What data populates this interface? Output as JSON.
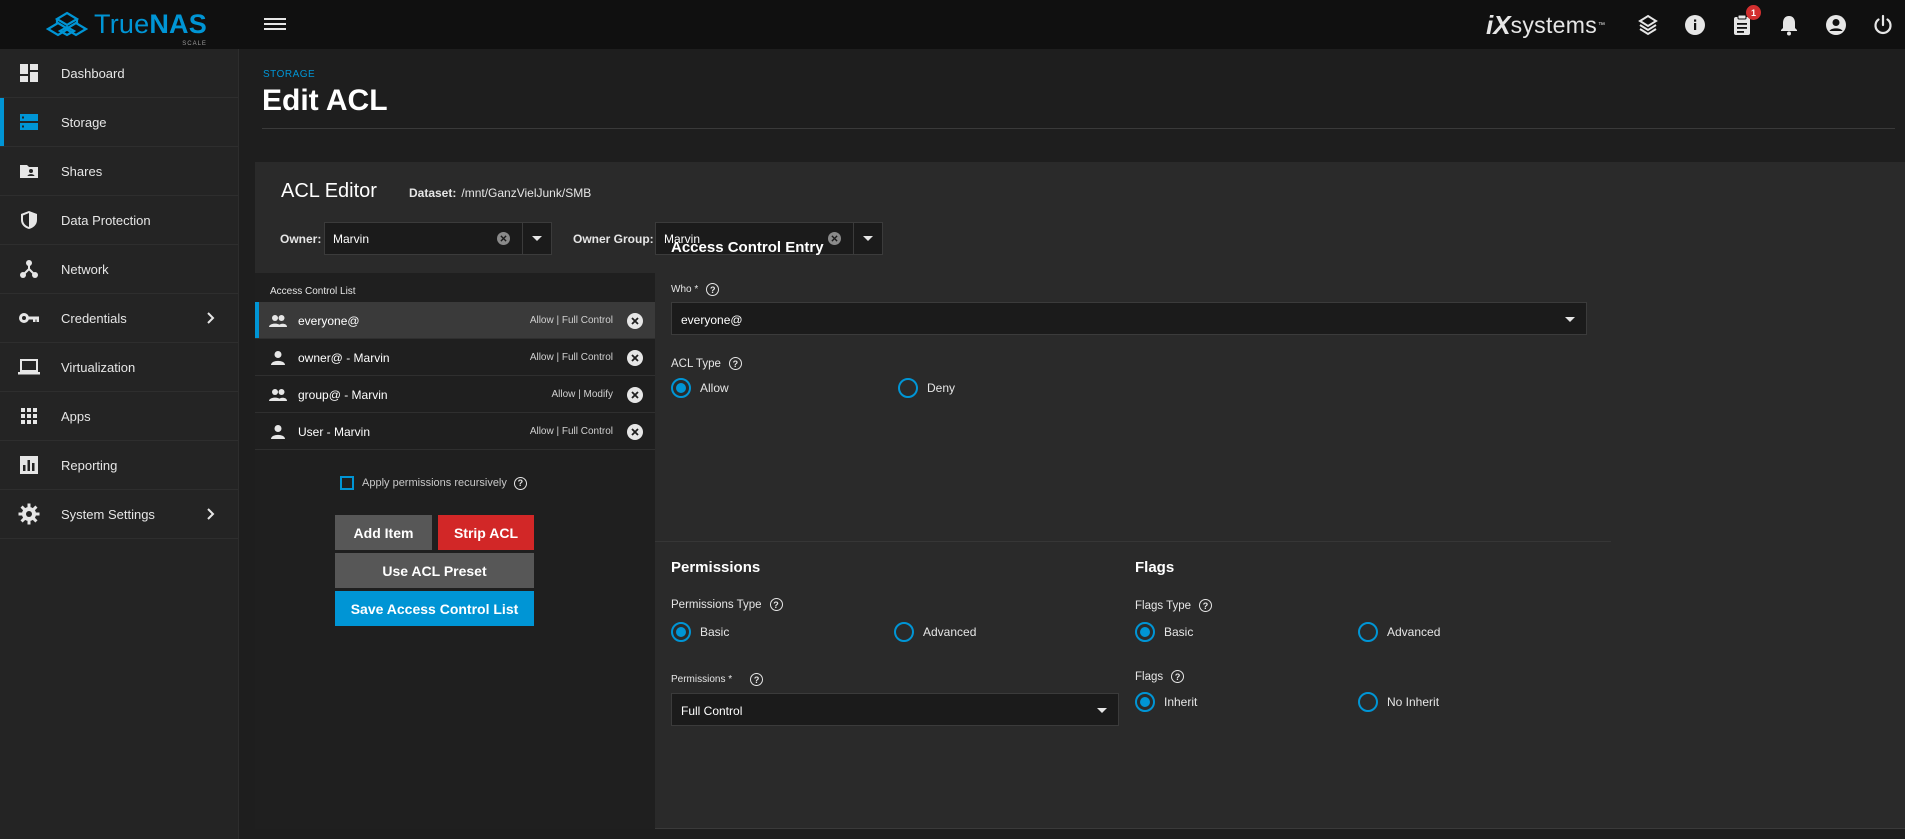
{
  "brand": {
    "name_light": "True",
    "name_bold": "NAS",
    "edition": "SCALE",
    "vendor_ix": "iX",
    "vendor_rest": "systems",
    "vendor_tm": "™",
    "accent": "#0095d5"
  },
  "topbar": {
    "icons": [
      "truecommand-icon",
      "info-icon",
      "tasks-icon",
      "notifications-icon",
      "account-icon",
      "power-icon"
    ],
    "tasks_badge": "1"
  },
  "sidebar": {
    "items": [
      {
        "label": "Dashboard",
        "icon": "dashboard-icon"
      },
      {
        "label": "Storage",
        "icon": "storage-icon",
        "active": true
      },
      {
        "label": "Shares",
        "icon": "shares-icon"
      },
      {
        "label": "Data Protection",
        "icon": "shield-icon"
      },
      {
        "label": "Network",
        "icon": "network-icon"
      },
      {
        "label": "Credentials",
        "icon": "key-icon",
        "submenu": true
      },
      {
        "label": "Virtualization",
        "icon": "laptop-icon"
      },
      {
        "label": "Apps",
        "icon": "apps-grid-icon"
      },
      {
        "label": "Reporting",
        "icon": "chart-icon"
      },
      {
        "label": "System Settings",
        "icon": "gear-icon",
        "submenu": true
      }
    ]
  },
  "header": {
    "breadcrumb": "STORAGE",
    "title": "Edit ACL"
  },
  "editor": {
    "title": "ACL Editor",
    "dataset_label": "Dataset:",
    "dataset_value": "/mnt/GanzVielJunk/SMB",
    "owner_label": "Owner:",
    "owner_value": "Marvin",
    "owner_group_label": "Owner Group:",
    "owner_group_value": "Marvin"
  },
  "acl_list": {
    "title": "Access Control List",
    "entries": [
      {
        "name": "everyone@",
        "perm": "Allow | Full Control",
        "icon": "group-icon",
        "selected": true
      },
      {
        "name": "owner@ - Marvin",
        "perm": "Allow | Full Control",
        "icon": "person-icon"
      },
      {
        "name": "group@ - Marvin",
        "perm": "Allow | Modify",
        "icon": "group-icon"
      },
      {
        "name": "User - Marvin",
        "perm": "Allow | Full Control",
        "icon": "person-icon"
      }
    ],
    "recursive_label": "Apply permissions recursively",
    "recursive_checked": false
  },
  "actions": {
    "add_item": "Add Item",
    "strip_acl": "Strip ACL",
    "use_preset": "Use ACL Preset",
    "save": "Save Access Control List"
  },
  "entry": {
    "title": "Access Control Entry",
    "who_label": "Who *",
    "who_value": "everyone@",
    "acl_type_label": "ACL Type",
    "acl_type_options": [
      "Allow",
      "Deny"
    ],
    "acl_type_selected": "Allow"
  },
  "permissions": {
    "title": "Permissions",
    "type_label": "Permissions Type",
    "type_options": [
      "Basic",
      "Advanced"
    ],
    "type_selected": "Basic",
    "perm_label": "Permissions *",
    "perm_value": "Full Control"
  },
  "flags": {
    "title": "Flags",
    "type_label": "Flags Type",
    "type_options": [
      "Basic",
      "Advanced"
    ],
    "type_selected": "Basic",
    "flags_label": "Flags",
    "flags_options": [
      "Inherit",
      "No Inherit"
    ],
    "flags_selected": "Inherit"
  }
}
